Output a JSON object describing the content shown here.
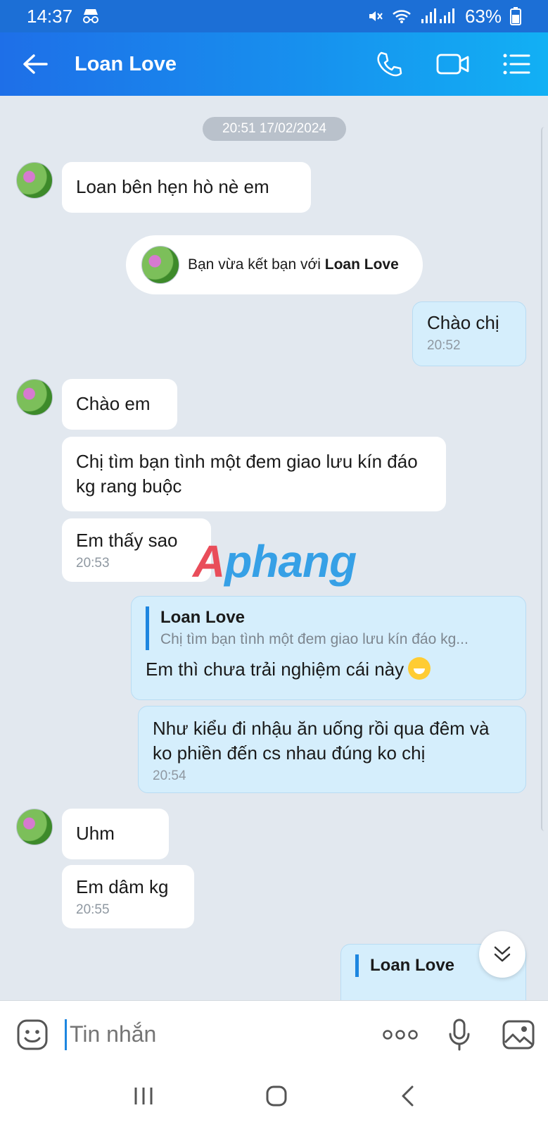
{
  "status": {
    "time": "14:37",
    "battery": "63%",
    "icons": [
      "incognito-icon",
      "mute-icon",
      "wifi-icon",
      "signal-icon",
      "battery-icon"
    ]
  },
  "header": {
    "title": "Loan Love",
    "icons": [
      "back-arrow-icon",
      "phone-icon",
      "video-icon",
      "list-icon"
    ]
  },
  "chat": {
    "date": "20:51 17/02/2024",
    "system": {
      "prefix": "Bạn vừa kết bạn với",
      "name": "Loan Love"
    },
    "messages": [
      {
        "text": "Loan bên hẹn hò nè em"
      },
      {
        "text": "Chào chị",
        "time": "20:52"
      },
      {
        "text": "Chào em"
      },
      {
        "text": "Chị tìm bạn tình một đem giao lưu kín đáo kg rang buộc"
      },
      {
        "text": "Em thấy sao",
        "time": "20:53"
      },
      {
        "quote_name": "Loan Love",
        "quote_text": "Chị tìm bạn tình một đem giao lưu kín đáo kg...",
        "text": "Em thì chưa trải nghiệm cái này"
      },
      {
        "text": "Như kiểu đi nhậu ăn uống rồi qua đêm và ko phiền đến cs nhau đúng ko chị",
        "time": "20:54"
      },
      {
        "text": "Uhm"
      },
      {
        "text": "Em dâm kg",
        "time": "20:55"
      },
      {
        "quote_name": "Loan Love"
      }
    ],
    "watermark": "Aphang"
  },
  "input": {
    "placeholder": "Tin nhắn"
  },
  "colors": {
    "header_start": "#1e6fe8",
    "header_end": "#12b0f4",
    "my_bubble": "#d5eefc",
    "chat_bg": "#e2e8ef"
  }
}
